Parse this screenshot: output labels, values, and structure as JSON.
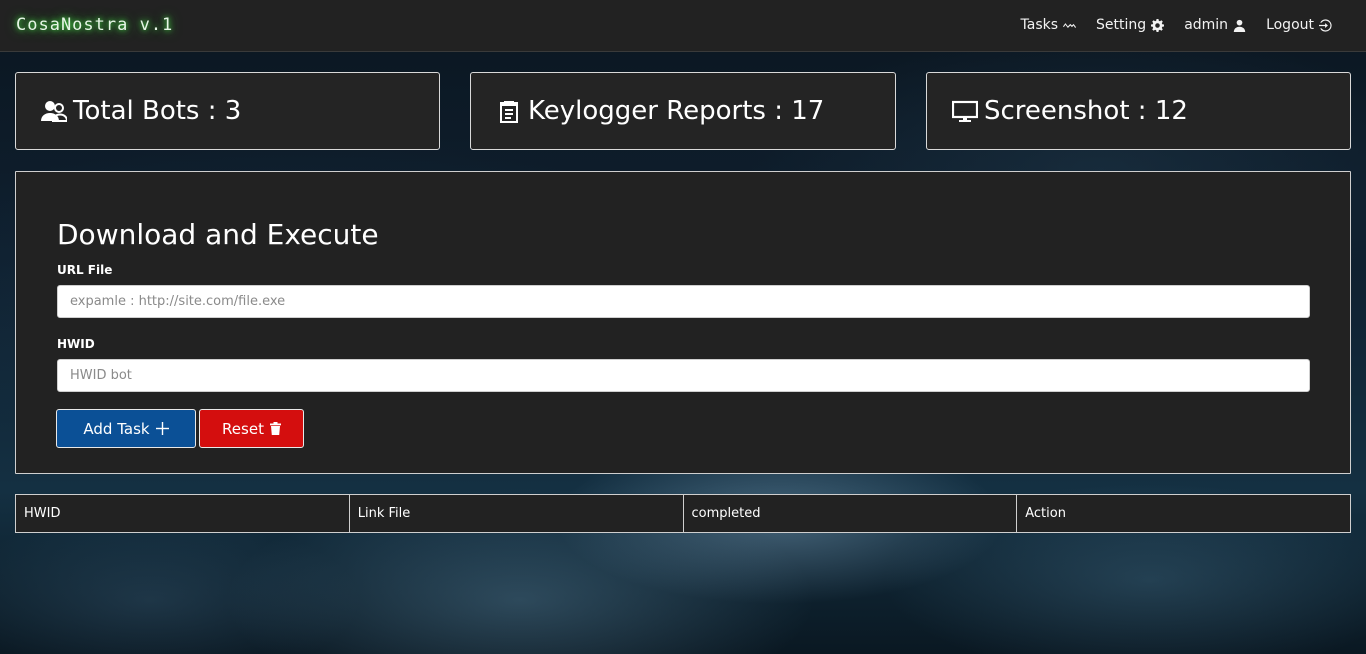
{
  "navbar": {
    "brand": "CosaNostra v.1",
    "items": [
      {
        "label": "Tasks",
        "icon": "activity-icon"
      },
      {
        "label": "Setting",
        "icon": "gear-icon"
      },
      {
        "label": "admin",
        "icon": "user-icon"
      },
      {
        "label": "Logout",
        "icon": "logout-icon"
      }
    ]
  },
  "stats": [
    {
      "label": "Total Bots",
      "value": "3",
      "icon": "users-icon"
    },
    {
      "label": "Keylogger Reports",
      "value": "17",
      "icon": "clipboard-icon"
    },
    {
      "label": "Screenshot",
      "value": "12",
      "icon": "monitor-icon"
    }
  ],
  "task_form": {
    "title": "Download and Execute",
    "url_label": "URL File",
    "url_placeholder": "expamle : http://site.com/file.exe",
    "url_value": "",
    "hwid_label": "HWID",
    "hwid_placeholder": "HWID bot",
    "hwid_value": "",
    "add_button": "Add Task",
    "reset_button": "Reset"
  },
  "table": {
    "columns": [
      "HWID",
      "Link File",
      "completed",
      "Action"
    ],
    "rows": []
  },
  "colors": {
    "navbar_bg": "#222222",
    "panel_bg": "#222222",
    "add_button": "#0b5096",
    "reset_button": "#d40e0e",
    "brand_glow": "#4cff4c"
  }
}
